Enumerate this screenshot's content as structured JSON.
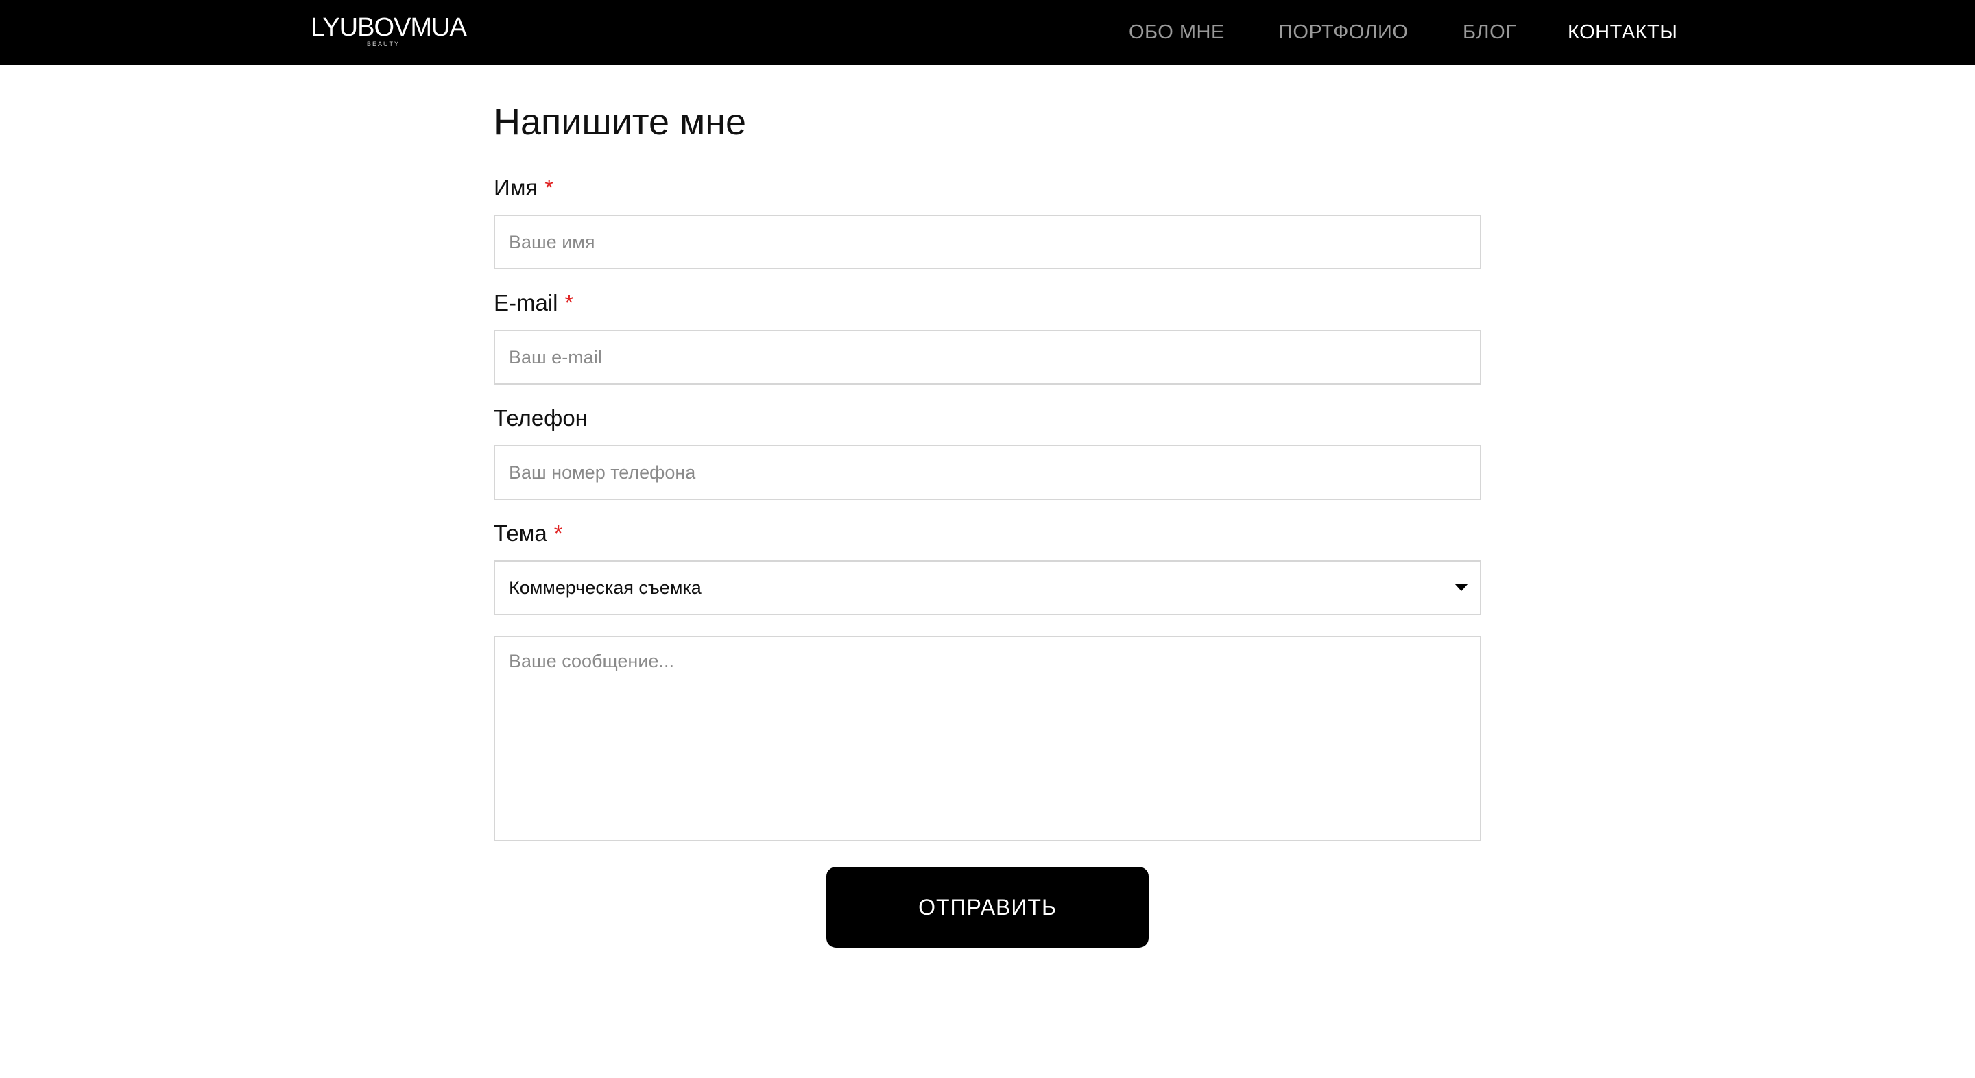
{
  "header": {
    "logo": {
      "text": "LYUBOVMUA",
      "subtext": "BEAUTY"
    },
    "nav": [
      {
        "label": "ОБО МНЕ",
        "active": false
      },
      {
        "label": "ПОРТФОЛИО",
        "active": false
      },
      {
        "label": "БЛОГ",
        "active": false
      },
      {
        "label": "КОНТАКТЫ",
        "active": true
      }
    ],
    "colors": {
      "background": "#000000",
      "nav_inactive": "#9a9a9a",
      "nav_active": "#ffffff"
    }
  },
  "form": {
    "title": "Напишите мне",
    "required_marker": "*",
    "fields": {
      "name": {
        "label": "Имя",
        "required": true,
        "placeholder": "Ваше имя",
        "value": ""
      },
      "email": {
        "label": "E-mail",
        "required": true,
        "placeholder": "Ваш e-mail",
        "value": ""
      },
      "phone": {
        "label": "Телефон",
        "required": false,
        "placeholder": "Ваш номер телефона",
        "value": ""
      },
      "topic": {
        "label": "Тема",
        "required": true,
        "selected": "Коммерческая съемка"
      },
      "message": {
        "placeholder": "Ваше сообщение...",
        "value": ""
      }
    },
    "submit_label": "ОТПРАВИТЬ",
    "colors": {
      "required": "#e02424",
      "border": "#d6d6d6",
      "button": "#000000"
    }
  }
}
